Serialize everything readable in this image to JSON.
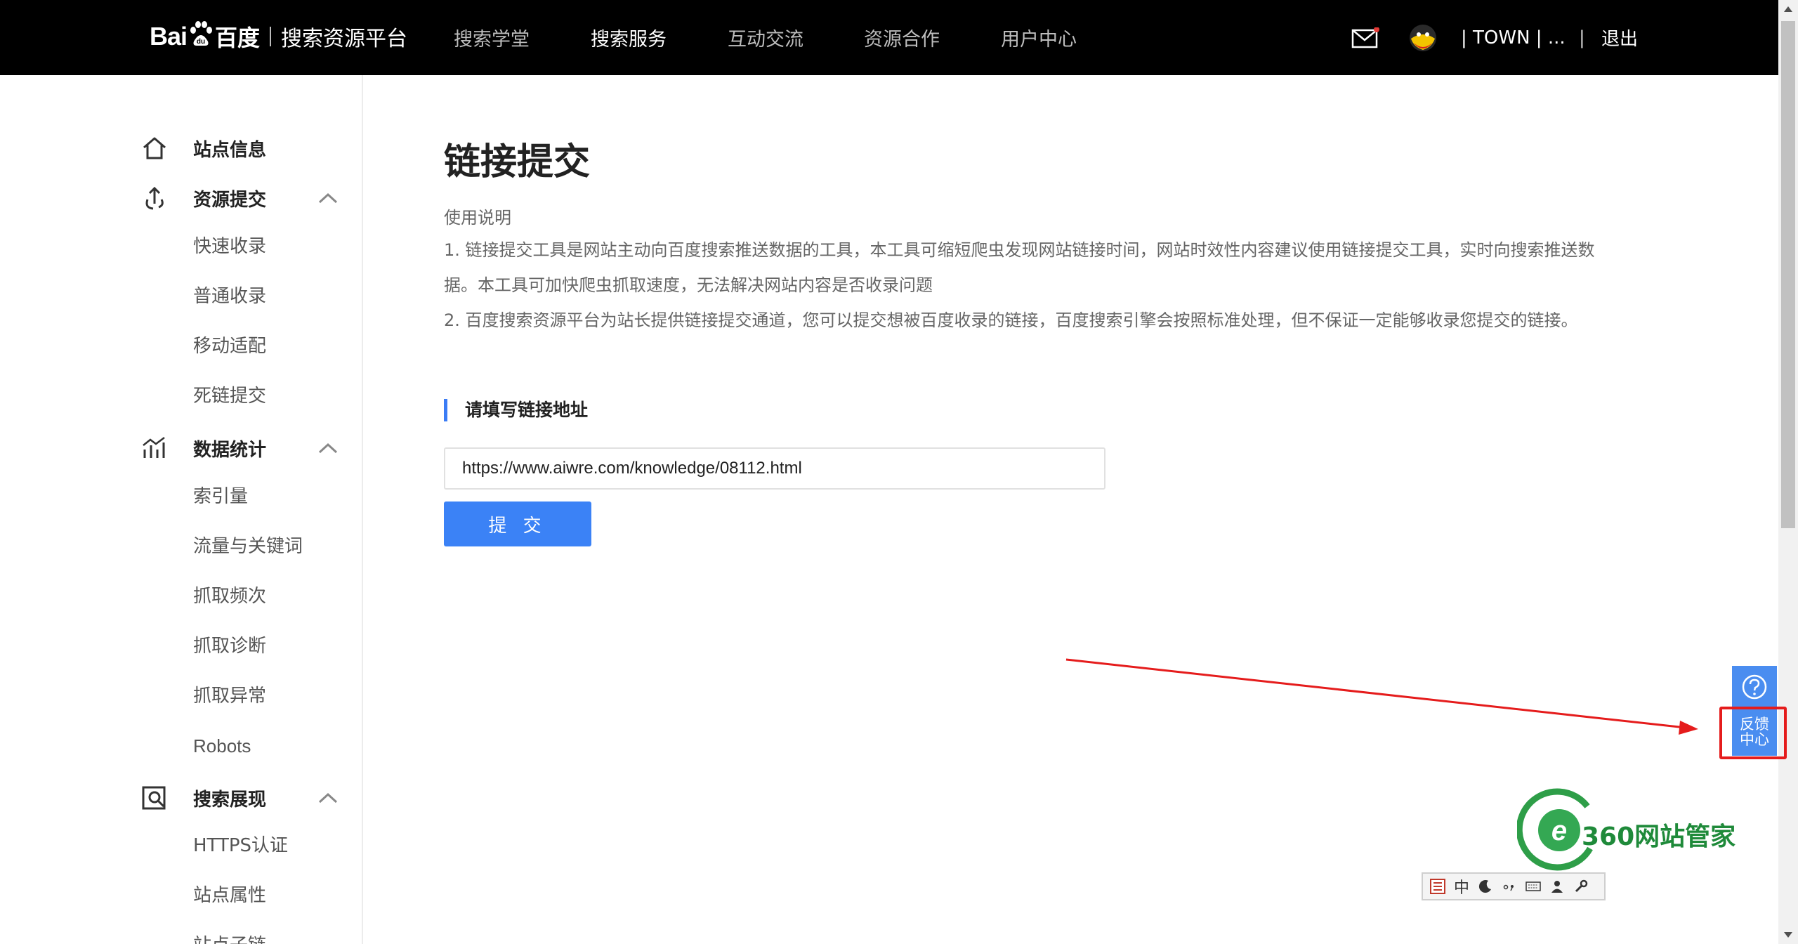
{
  "header": {
    "logo_baidu": "Bai",
    "logo_du": "du",
    "logo_cn": "百度",
    "logo_platform": "搜索资源平台",
    "nav": [
      {
        "label": "搜索学堂"
      },
      {
        "label": "搜索服务"
      },
      {
        "label": "互动交流"
      },
      {
        "label": "资源合作"
      },
      {
        "label": "用户中心"
      }
    ],
    "user_label": "| TOWN | ...",
    "divider": "|",
    "logout_label": "退出"
  },
  "sidebar": {
    "groups": [
      {
        "label": "站点信息",
        "icon": "home-icon"
      },
      {
        "label": "资源提交",
        "icon": "upload-icon",
        "items": [
          "快速收录",
          "普通收录",
          "移动适配",
          "死链提交"
        ]
      },
      {
        "label": "数据统计",
        "icon": "stats-icon",
        "items": [
          "索引量",
          "流量与关键词",
          "抓取频次",
          "抓取诊断",
          "抓取异常",
          "Robots"
        ]
      },
      {
        "label": "搜索展现",
        "icon": "search-display-icon",
        "items": [
          "HTTPS认证",
          "站点属性",
          "站点子链"
        ]
      }
    ]
  },
  "main": {
    "title": "链接提交",
    "usage_title": "使用说明",
    "usage_lines": [
      "1. 链接提交工具是网站主动向百度搜索推送数据的工具，本工具可缩短爬虫发现网站链接时间，网站时效性内容建议使用链接提交工具，实时向搜索推送数",
      "据。本工具可加快爬虫抓取速度，无法解决网站内容是否收录问题",
      "2. 百度搜索资源平台为站长提供链接提交通道，您可以提交想被百度收录的链接，百度搜索引擎会按照标准处理，但不保证一定能够收录您提交的链接。"
    ],
    "section_title": "请填写链接地址",
    "url_value": "https://www.aiwre.com/knowledge/08112.html",
    "submit_label": "提 交"
  },
  "floating": {
    "feedback_line1": "反馈",
    "feedback_line2": "中心"
  },
  "watermark": {
    "text": "360网站管家"
  },
  "ime": {
    "mode": "中"
  },
  "colors": {
    "topbar": "#000000",
    "accent_blue": "#3b82f6",
    "highlight_red": "#e51c1c",
    "watermark_green": "#1f8a3a"
  }
}
